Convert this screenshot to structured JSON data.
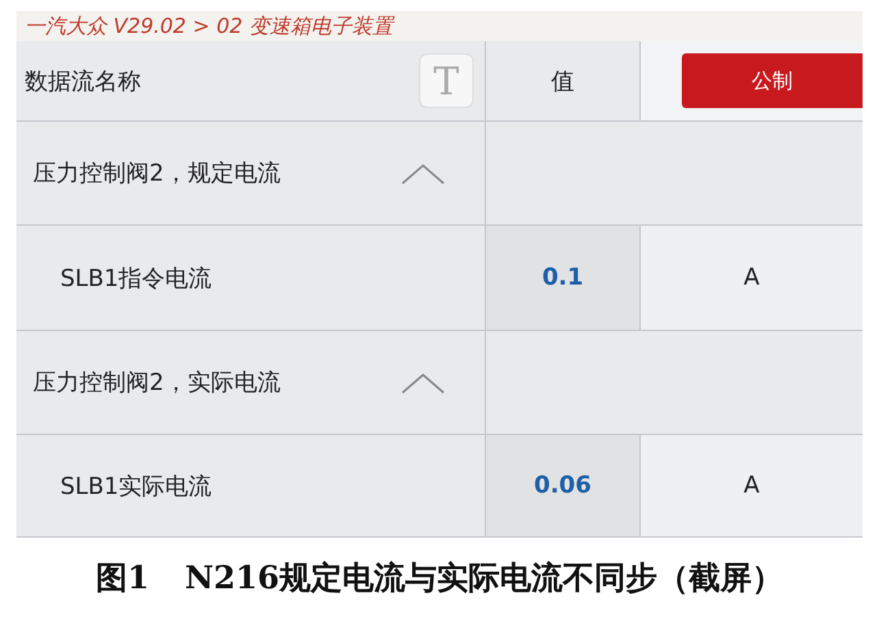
{
  "breadcrumb": "一汽大众 V29.02 > 02 变速箱电子装置",
  "header": {
    "name_label": "数据流名称",
    "text_button": "T",
    "value_label": "值",
    "unit_button": "公制"
  },
  "groups": [
    {
      "title": "压力控制阀2，规定电流",
      "expanded": true,
      "items": [
        {
          "name": "SLB1指令电流",
          "value": "0.1",
          "unit": "A"
        }
      ]
    },
    {
      "title": "压力控制阀2，实际电流",
      "expanded": true,
      "items": [
        {
          "name": "SLB1实际电流",
          "value": "0.06",
          "unit": "A"
        }
      ]
    }
  ],
  "caption": {
    "number": "图1",
    "text": "N216规定电流与实际电流不同步（截屏）"
  }
}
